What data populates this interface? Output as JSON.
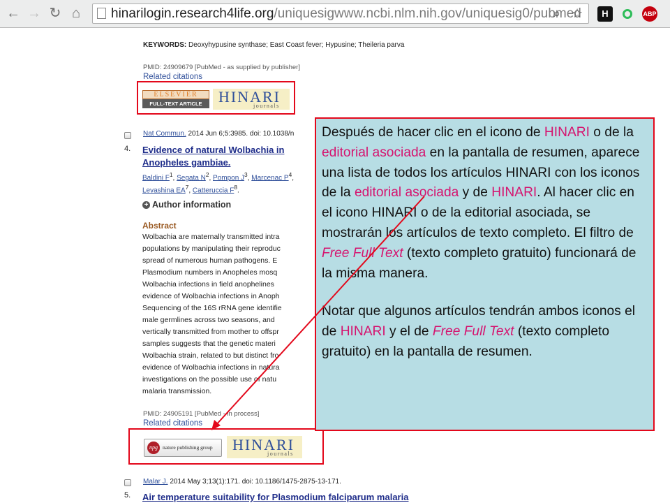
{
  "browser": {
    "url_host": "hinarilogin.research4life.org",
    "url_path": "/uniquesigwww.ncbi.nlm.nih.gov/uniquesig0/pubmed",
    "extensions": [
      "H",
      "ABP"
    ]
  },
  "result3": {
    "keywords_label": "KEYWORDS:",
    "keywords": "Deoxyhypusine synthase; East Coast fever; Hypusine; Theileria parva",
    "pmid": "PMID: 24909679 [PubMed - as supplied by publisher]",
    "related": "Related citations",
    "publisher_logo": {
      "line1": "ELSEVIER",
      "line2": "FULL-TEXT ARTICLE"
    },
    "hinari_logo": {
      "main": "HINARI",
      "sub": "journals"
    }
  },
  "result4": {
    "number": "4.",
    "journal": "Nat Commun.",
    "citation": "2014 Jun 6;5:3985. doi: 10.1038/n",
    "title_line1": "Evidence of natural Wolbachia in",
    "title_line2": "Anopheles gambiae.",
    "authors_line1": [
      {
        "name": "Baldini F",
        "sup": "1"
      },
      {
        "name": "Segata N",
        "sup": "2"
      },
      {
        "name": "Pompon J",
        "sup": "3"
      },
      {
        "name": "Marcenac P",
        "sup": "4"
      }
    ],
    "authors_line2": [
      {
        "name": "Levashina EA",
        "sup": "7"
      },
      {
        "name": "Catteruccia F",
        "sup": "8"
      }
    ],
    "author_info": "Author information",
    "abstract_heading": "Abstract",
    "abstract_lines": [
      "Wolbachia are maternally transmitted intra",
      "populations by manipulating their reproduc",
      "spread of numerous human pathogens. E",
      "Plasmodium numbers in Anopheles mosq",
      "Wolbachia infections in field anophelines",
      "evidence of Wolbachia infections in Anoph",
      "Sequencing of the 16S rRNA gene identifie",
      "male germlines across two seasons, and",
      "vertically transmitted from mother to offspr",
      "samples suggests that the genetic materi",
      "Wolbachia strain, related to but distinct fro",
      "evidence of Wolbachia infections in natura",
      "investigations on the possible use of natu",
      "malaria transmission."
    ],
    "pmid": "PMID: 24905191 [PubMed - in process]",
    "related": "Related citations",
    "publisher_logo": {
      "badge": "npg",
      "text": "nature publishing group"
    },
    "hinari_logo": {
      "main": "HINARI",
      "sub": "journals"
    }
  },
  "result5": {
    "number": "5.",
    "journal": "Malar J.",
    "citation": "2014 May 3;13(1):171. doi: 10.1186/1475-2875-13-171.",
    "title": "Air temperature suitability for Plasmodium falciparum malaria"
  },
  "callout": {
    "p1": [
      {
        "t": "Después de hacer clic en el icono de ",
        "s": ""
      },
      {
        "t": "HINARI",
        "s": "pink"
      },
      {
        "t": " o de la ",
        "s": ""
      },
      {
        "t": "editorial asociada",
        "s": "pink"
      },
      {
        "t": " en la pantalla de resumen, aparece una lista de todos los artículos HINARI con los iconos de la ",
        "s": ""
      },
      {
        "t": "editorial asociada",
        "s": "pink"
      },
      {
        "t": " y de ",
        "s": ""
      },
      {
        "t": "HINARI",
        "s": "pink"
      },
      {
        "t": ". Al hacer clic en el icono HINARI o de la editorial asociada, se mostrarán los artículos de texto completo. El filtro de ",
        "s": ""
      },
      {
        "t": "Free Full Text",
        "s": "pink-i"
      },
      {
        "t": " (texto completo gratuito) funcionará de la misma manera.",
        "s": ""
      }
    ],
    "p2": [
      {
        "t": "Notar que algunos artículos tendrán ambos iconos el de ",
        "s": ""
      },
      {
        "t": "HINARI",
        "s": "pink"
      },
      {
        "t": " y el de ",
        "s": ""
      },
      {
        "t": "Free Full Text",
        "s": "pink-i"
      },
      {
        "t": " (texto completo gratuito) en la pantalla de resumen.",
        "s": ""
      }
    ]
  },
  "colors": {
    "highlight_border": "#e3081b",
    "callout_bg": "#b7dde4",
    "accent_text": "#d5146f"
  }
}
